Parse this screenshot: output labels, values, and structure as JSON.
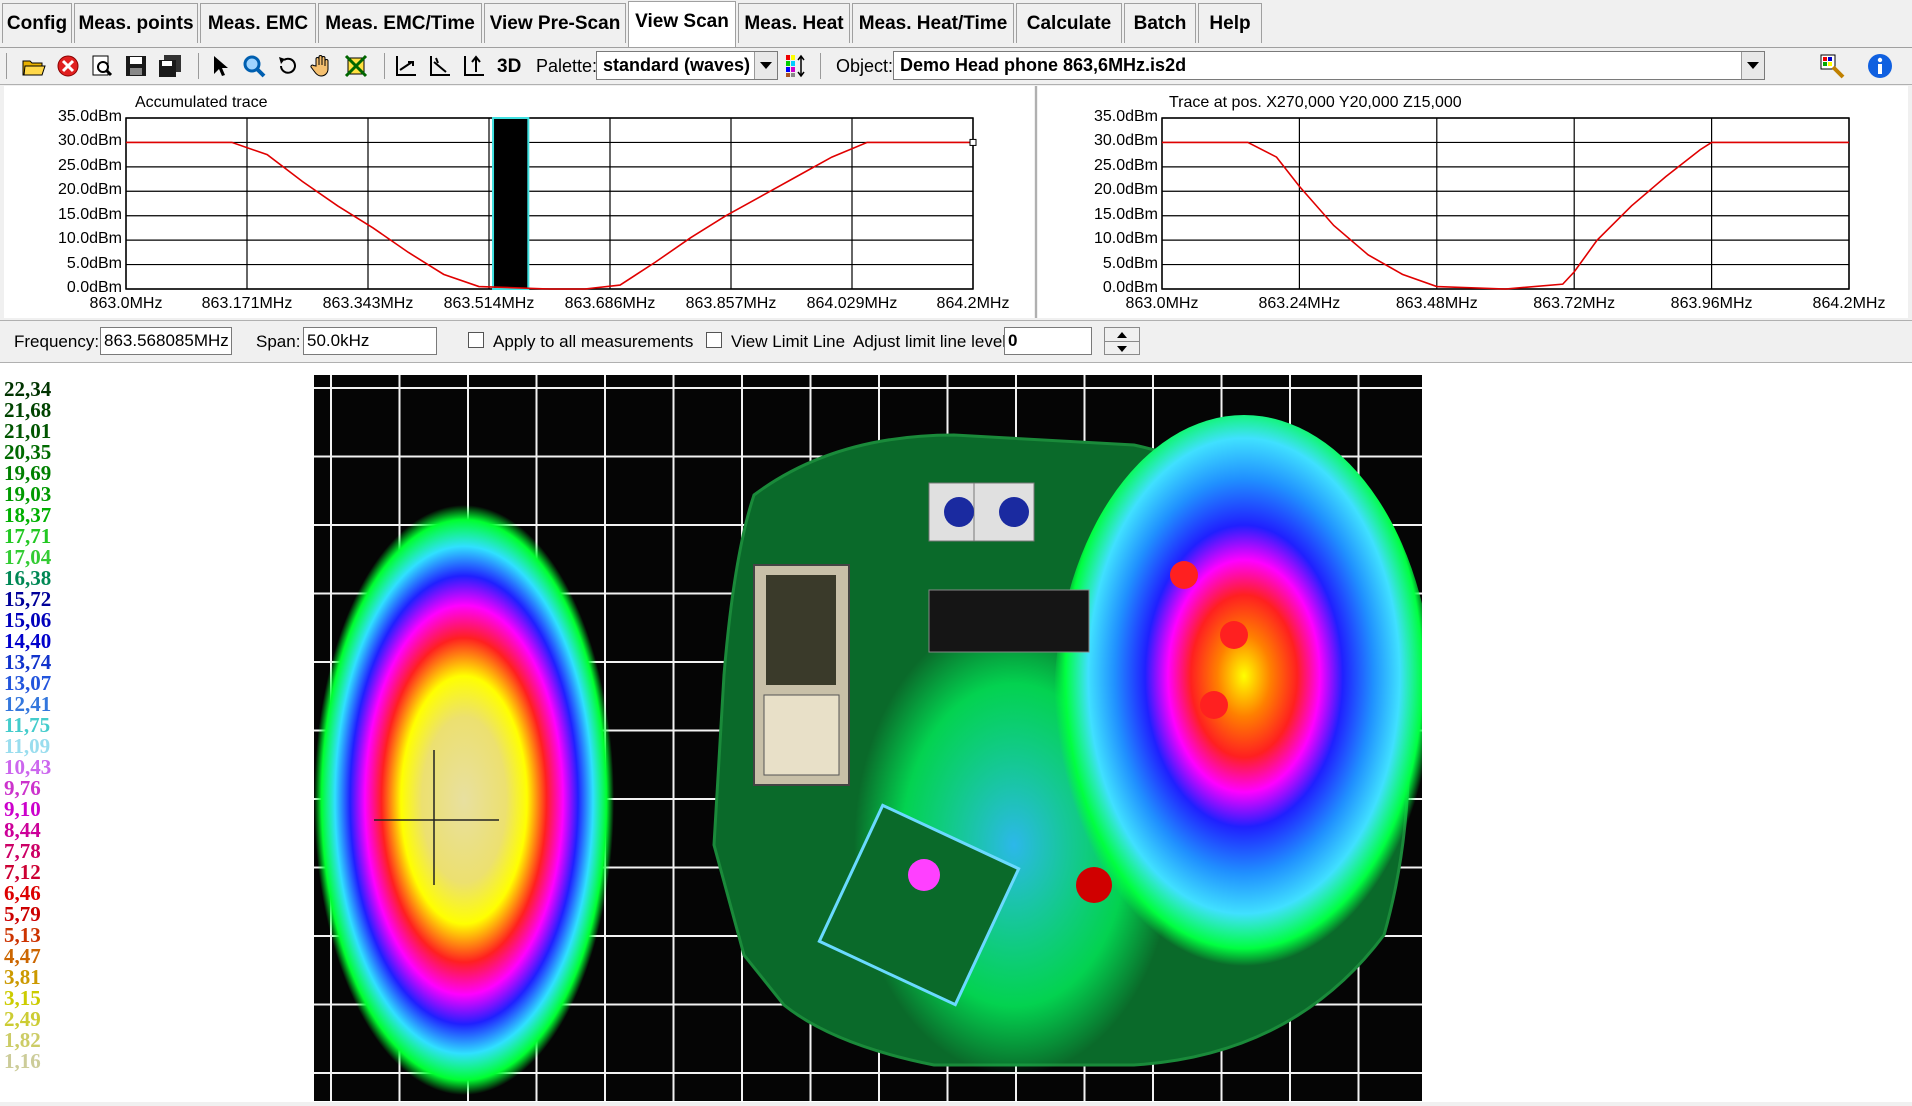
{
  "menu": {
    "tabs": [
      {
        "label": "Config"
      },
      {
        "label": "Meas. points"
      },
      {
        "label": "Meas. EMC"
      },
      {
        "label": "Meas. EMC/Time"
      },
      {
        "label": "View Pre-Scan"
      },
      {
        "label": "View Scan",
        "active": true
      },
      {
        "label": "Meas. Heat"
      },
      {
        "label": "Meas. Heat/Time"
      },
      {
        "label": "Calculate"
      },
      {
        "label": "Batch"
      },
      {
        "label": "Help"
      }
    ]
  },
  "toolbar": {
    "icons": [
      "open-folder-icon",
      "close-red-icon",
      "print-preview-icon",
      "save-icon",
      "save-all-icon",
      "pointer-icon",
      "zoom-icon",
      "rotate-icon",
      "pan-hand-icon",
      "fit-icon",
      "axis-x-icon",
      "axis-xy-icon",
      "axis-y-icon"
    ],
    "three_d_label": "3D",
    "palette_label": "Palette:",
    "palette_value": "standard (waves)",
    "object_label": "Object:",
    "object_value": "Demo Head phone 863,6MHz.is2d"
  },
  "chart_data": [
    {
      "type": "line",
      "title": "Accumulated trace",
      "x_tick_labels": [
        "863.0MHz",
        "863.171MHz",
        "863.343MHz",
        "863.514MHz",
        "863.686MHz",
        "863.857MHz",
        "864.029MHz",
        "864.2MHz"
      ],
      "y_tick_labels": [
        "35.0dBm",
        "30.0dBm",
        "25.0dBm",
        "20.0dBm",
        "15.0dBm",
        "10.0dBm",
        "5.0dBm",
        "0.0dBm"
      ],
      "xlim": [
        863.0,
        864.2
      ],
      "ylim": [
        0,
        35
      ],
      "grid": true,
      "series": [
        {
          "color": "#e00000",
          "x": [
            863.0,
            863.15,
            863.2,
            863.25,
            863.3,
            863.35,
            863.4,
            863.45,
            863.5,
            863.6,
            863.65,
            863.7,
            863.75,
            863.8,
            863.85,
            863.9,
            863.95,
            864.0,
            864.05,
            864.2
          ],
          "y": [
            30,
            30,
            27.5,
            22,
            17,
            12.5,
            7.5,
            3,
            0.5,
            0,
            0,
            0.8,
            5.5,
            10.5,
            15,
            19,
            23,
            27,
            30,
            30
          ]
        }
      ],
      "marker_band": {
        "x0": 863.52,
        "x1": 863.57
      }
    },
    {
      "type": "line",
      "title": "Trace at pos. X270,000 Y20,000 Z15,000",
      "x_tick_labels": [
        "863.0MHz",
        "863.24MHz",
        "863.48MHz",
        "863.72MHz",
        "863.96MHz",
        "864.2MHz"
      ],
      "y_tick_labels": [
        "35.0dBm",
        "30.0dBm",
        "25.0dBm",
        "20.0dBm",
        "15.0dBm",
        "10.0dBm",
        "5.0dBm",
        "0.0dBm"
      ],
      "xlim": [
        863.0,
        864.2
      ],
      "ylim": [
        0,
        35
      ],
      "grid": true,
      "series": [
        {
          "color": "#e00000",
          "x": [
            863.0,
            863.15,
            863.2,
            863.24,
            863.3,
            863.36,
            863.42,
            863.48,
            863.6,
            863.7,
            863.72,
            863.76,
            863.82,
            863.88,
            863.94,
            863.96,
            864.2
          ],
          "y": [
            30,
            30,
            27,
            21,
            13,
            7,
            3,
            0.5,
            0,
            1,
            3.5,
            10,
            17,
            23,
            28.5,
            30,
            30
          ]
        }
      ]
    }
  ],
  "freqbar": {
    "frequency_label": "Frequency:",
    "frequency_value": "863.568085MHz",
    "span_label": "Span:",
    "span_value": "50.0kHz",
    "apply_label": "Apply to all measurements",
    "view_limit_label": "View Limit Line",
    "adjust_label": "Adjust limit line level:",
    "adjust_value": "0"
  },
  "legend": [
    {
      "value": "22,34",
      "color": "#003300"
    },
    {
      "value": "21,68",
      "color": "#004400"
    },
    {
      "value": "21,01",
      "color": "#005500"
    },
    {
      "value": "20,35",
      "color": "#006a00"
    },
    {
      "value": "19,69",
      "color": "#008000"
    },
    {
      "value": "19,03",
      "color": "#009a00"
    },
    {
      "value": "18,37",
      "color": "#00b000"
    },
    {
      "value": "17,71",
      "color": "#22c822"
    },
    {
      "value": "17,04",
      "color": "#33cc33"
    },
    {
      "value": "16,38",
      "color": "#008855"
    },
    {
      "value": "15,72",
      "color": "#000099"
    },
    {
      "value": "15,06",
      "color": "#0000bb"
    },
    {
      "value": "14,40",
      "color": "#0000cc"
    },
    {
      "value": "13,74",
      "color": "#1133cc"
    },
    {
      "value": "13,07",
      "color": "#2255dd"
    },
    {
      "value": "12,41",
      "color": "#3377dd"
    },
    {
      "value": "11,75",
      "color": "#44cccc"
    },
    {
      "value": "11,09",
      "color": "#99ddee"
    },
    {
      "value": "10,43",
      "color": "#cc66ee"
    },
    {
      "value": "9,76",
      "color": "#cc33cc"
    },
    {
      "value": "9,10",
      "color": "#cc00cc"
    },
    {
      "value": "8,44",
      "color": "#cc0099"
    },
    {
      "value": "7,78",
      "color": "#cc0066"
    },
    {
      "value": "7,12",
      "color": "#cc0033"
    },
    {
      "value": "6,46",
      "color": "#dd0000"
    },
    {
      "value": "5,79",
      "color": "#cc0000"
    },
    {
      "value": "5,13",
      "color": "#cc3300"
    },
    {
      "value": "4,47",
      "color": "#cc6600"
    },
    {
      "value": "3,81",
      "color": "#cc9900"
    },
    {
      "value": "3,15",
      "color": "#cccc00"
    },
    {
      "value": "2,49",
      "color": "#cccc33"
    },
    {
      "value": "1,82",
      "color": "#cccc66"
    },
    {
      "value": "1,16",
      "color": "#cccc99"
    }
  ]
}
